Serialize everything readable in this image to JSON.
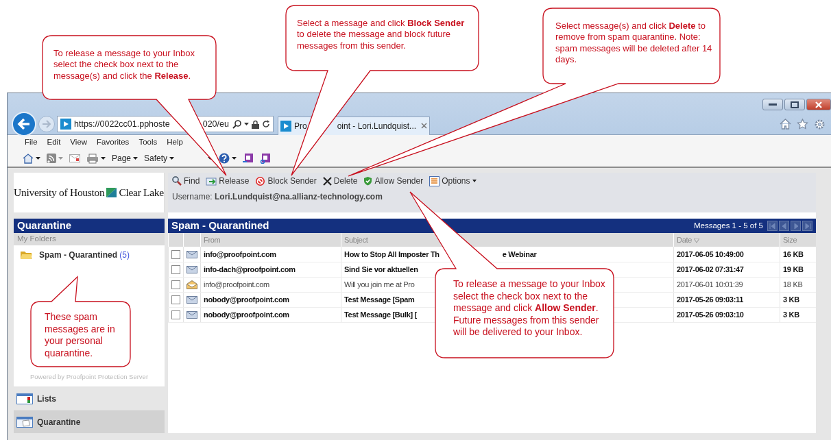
{
  "callouts": [
    {
      "text": "To release a message to your Inbox select the check box next to the message(s) and click the **Release**."
    },
    {
      "text": "Select a message and click **Block Sender** to delete the message and block future messages from this sender."
    },
    {
      "text": "Select message(s) and click **Delete** to remove from spam quarantine. Note: spam messages will be deleted after 14 days."
    },
    {
      "text": "To release a message to your Inbox select the check box next to the message and click **Allow Sender**.  Future messages from this sender will be delivered to your Inbox."
    },
    {
      "text": "These spam messages are in your personal quarantine."
    }
  ],
  "browser": {
    "address": "https://0022cc01.pphoste",
    "address_tail": "020/eu",
    "tab_title": "Pro",
    "tab_title_tail": "oint - Lori.Lundquist...",
    "menu": [
      "File",
      "Edit",
      "View",
      "Favorites",
      "Tools",
      "Help"
    ],
    "commands": [
      "Page",
      "Safety"
    ]
  },
  "logo": {
    "left": "University of Houston",
    "right": "Clear Lake"
  },
  "toolbar": {
    "buttons": [
      "Find",
      "Release",
      "Block Sender",
      "Delete",
      "Allow Sender",
      "Options"
    ],
    "username_label": "Username:",
    "username": "Lori.Lundquist@na.allianz-technology.com"
  },
  "sidebar": {
    "title": "Quarantine",
    "section": "My Folders",
    "folders": [
      {
        "name": "Spam - Quarantined",
        "count": "(5)"
      }
    ],
    "powered_by": "Powered by Proofpoint Protection Server",
    "nav": [
      {
        "label": "Lists",
        "selected": false
      },
      {
        "label": "Quarantine",
        "selected": true
      }
    ]
  },
  "list": {
    "title": "Spam - Quarantined",
    "paging": "Messages 1 - 5 of 5",
    "columns": [
      "From",
      "Subject",
      "Date",
      "Size"
    ],
    "rows": [
      {
        "from": "info@proofpoint.com",
        "subject": "How to Stop All Imposter Th",
        "subject_tail": "e Webinar",
        "date": "2017-06-05 10:49:00",
        "size": "16 KB",
        "unread": true,
        "checked": false
      },
      {
        "from": "info-dach@proofpoint.com",
        "subject": "Sind Sie vor aktuellen",
        "date": "2017-06-02 07:31:47",
        "size": "19 KB",
        "unread": true,
        "checked": false
      },
      {
        "from": "info@proofpoint.com",
        "subject": "Will you join me at Pro",
        "date": "2017-06-01 10:01:39",
        "size": "18 KB",
        "unread": false,
        "checked": false
      },
      {
        "from": "nobody@proofpoint.com",
        "subject": "Test Message [Spam",
        "date": "2017-05-26 09:03:11",
        "size": "3 KB",
        "unread": true,
        "checked": false
      },
      {
        "from": "nobody@proofpoint.com",
        "subject": "Test Message [Bulk] [",
        "date": "2017-05-26 09:03:10",
        "size": "3 KB",
        "unread": true,
        "checked": false
      }
    ]
  }
}
